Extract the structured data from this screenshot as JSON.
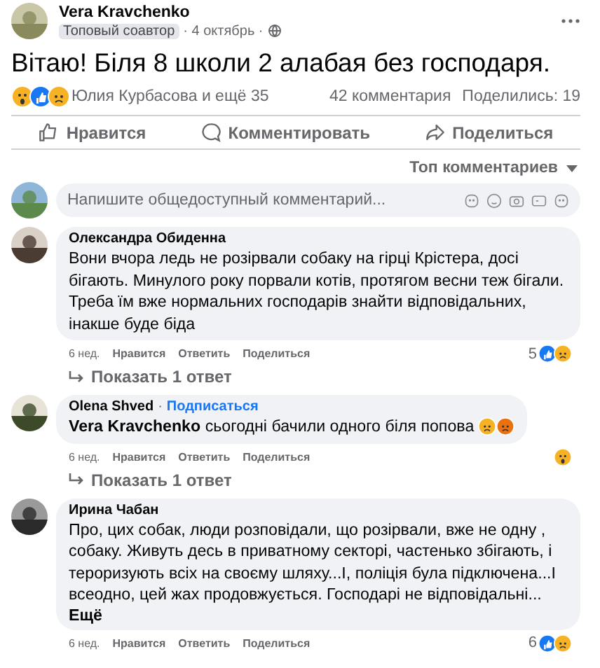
{
  "post": {
    "author": "Vera Kravchenko",
    "badge": "Топовый соавтор",
    "date": "· 4 октябрь ·",
    "text": "Вітаю! Біля 8 школи 2 алабая без господаря.",
    "reactors": "Юлия Курбасова и ещё 35",
    "comments_count": "42 комментария",
    "shares": "Поделились: 19"
  },
  "actions": [
    {
      "kind": "like",
      "label": "Нравится"
    },
    {
      "kind": "comment",
      "label": "Комментировать"
    },
    {
      "kind": "share",
      "label": "Поделиться"
    }
  ],
  "sort": {
    "label": "Топ комментариев"
  },
  "composer": {
    "placeholder": "Напишите общедоступный комментарий..."
  },
  "comments": [
    {
      "author": "Олександра Обиденна",
      "text": "Вони вчора ледь не розірвали собаку на гірці Крістера, досі бігають. Минулого року порвали котів, протягом весни теж бігали. Треба їм вже нормальних господарів знайти відповідальних, інакше буде біда",
      "time": "6 нед.",
      "like": "Нравится",
      "reply": "Ответить",
      "share": "Поделиться",
      "reaction_count": "5",
      "replies": "Показать 1 ответ"
    },
    {
      "author": "Olena Shved",
      "separator": "·",
      "follow": "Подписаться",
      "text": "**Vera Kravchenko** сьогодні бачили одного біля попова",
      "time": "6 нед.",
      "like": "Нравится",
      "reply": "Ответить",
      "share": "Поделиться",
      "replies": "Показать 1 ответ"
    },
    {
      "author": "Ирина Чабан",
      "text": "Про, цих собак, люди розповідали, що розірвали, вже не одну , собаку. Живуть десь в приватному секторі, частенько збігають, і тероризують всіх на своєму шляху...І, поліція була підключена...І всеодно, цей жах продовжується. Господарі не відповідальні...",
      "more": "Ещё",
      "time": "6 нед.",
      "like": "Нравится",
      "reply": "Ответить",
      "share": "Поделиться",
      "reaction_count": "6"
    }
  ]
}
